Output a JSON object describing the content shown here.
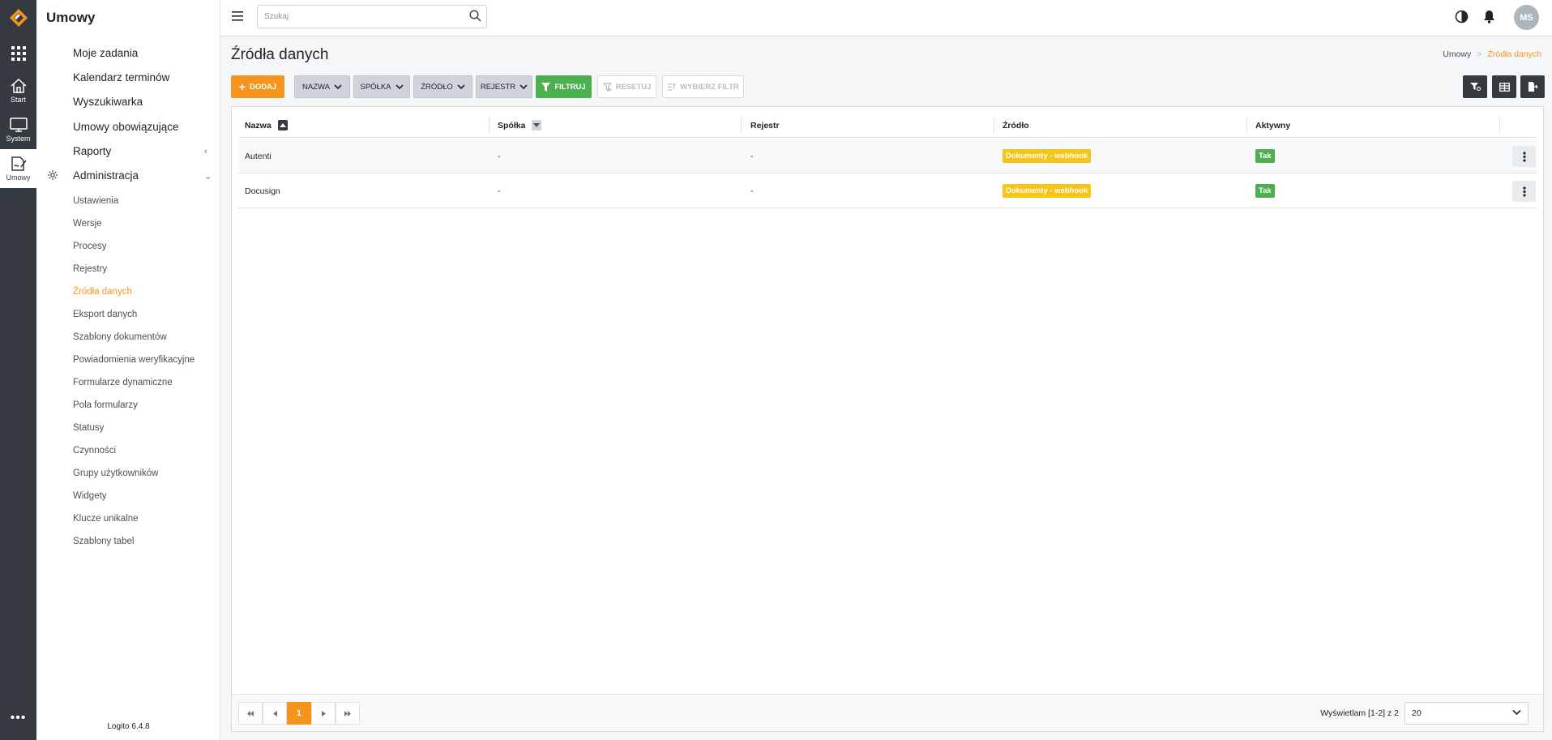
{
  "colors": {
    "accent": "#f7941d",
    "green": "#4caf50",
    "yellow": "#f5c518",
    "rail": "#343a40"
  },
  "rail": {
    "items": [
      {
        "label": "Start",
        "icon": "home-icon"
      },
      {
        "label": "System",
        "icon": "monitor-icon"
      },
      {
        "label": "Umowy",
        "icon": "contract-icon"
      }
    ],
    "more": "•••"
  },
  "sidebar": {
    "title": "Umowy",
    "items": [
      "Moje zadania",
      "Kalendarz terminów",
      "Wyszukiwarka",
      "Umowy obowiązujące",
      "Raporty",
      "Administracja"
    ],
    "sub_items": [
      "Ustawienia",
      "Wersje",
      "Procesy",
      "Rejestry",
      "Źródła danych",
      "Eksport danych",
      "Szablony dokumentów",
      "Powiadomienia weryfikacyjne",
      "Formularze dynamiczne",
      "Pola formularzy",
      "Statusy",
      "Czynności",
      "Grupy użytkowników",
      "Widgety",
      "Klucze unikalne",
      "Szablony tabel"
    ],
    "active_sub": "Źródła danych",
    "version": "Logito 6.4.8"
  },
  "topbar": {
    "search_placeholder": "Szukaj",
    "avatar_initials": "MS"
  },
  "page": {
    "title": "Źródła danych",
    "breadcrumb": {
      "root": "Umowy",
      "sep": ">",
      "current": "Źródła danych"
    }
  },
  "toolbar": {
    "add": "DODAJ",
    "filters": [
      "NAZWA",
      "SPÓŁKA",
      "ŹRÓDŁO",
      "REJESTR"
    ],
    "filter_btn": "FILTRUJ",
    "reset_btn": "RESETUJ",
    "choose_filter_btn": "WYBIERZ FILTR"
  },
  "table": {
    "columns": [
      "Nazwa",
      "Spółka",
      "Rejestr",
      "Źródło",
      "Aktywny"
    ],
    "rows": [
      {
        "nazwa": "Autenti",
        "spolka": "-",
        "rejestr": "-",
        "zrodlo": "Dokumenty - webhook",
        "aktywny": "Tak"
      },
      {
        "nazwa": "Docusign",
        "spolka": "-",
        "rejestr": "-",
        "zrodlo": "Dokumenty - webhook",
        "aktywny": "Tak"
      }
    ]
  },
  "pagination": {
    "current_page": "1",
    "showing": "Wyświetlam [1-2] z 2",
    "page_size": "20"
  }
}
